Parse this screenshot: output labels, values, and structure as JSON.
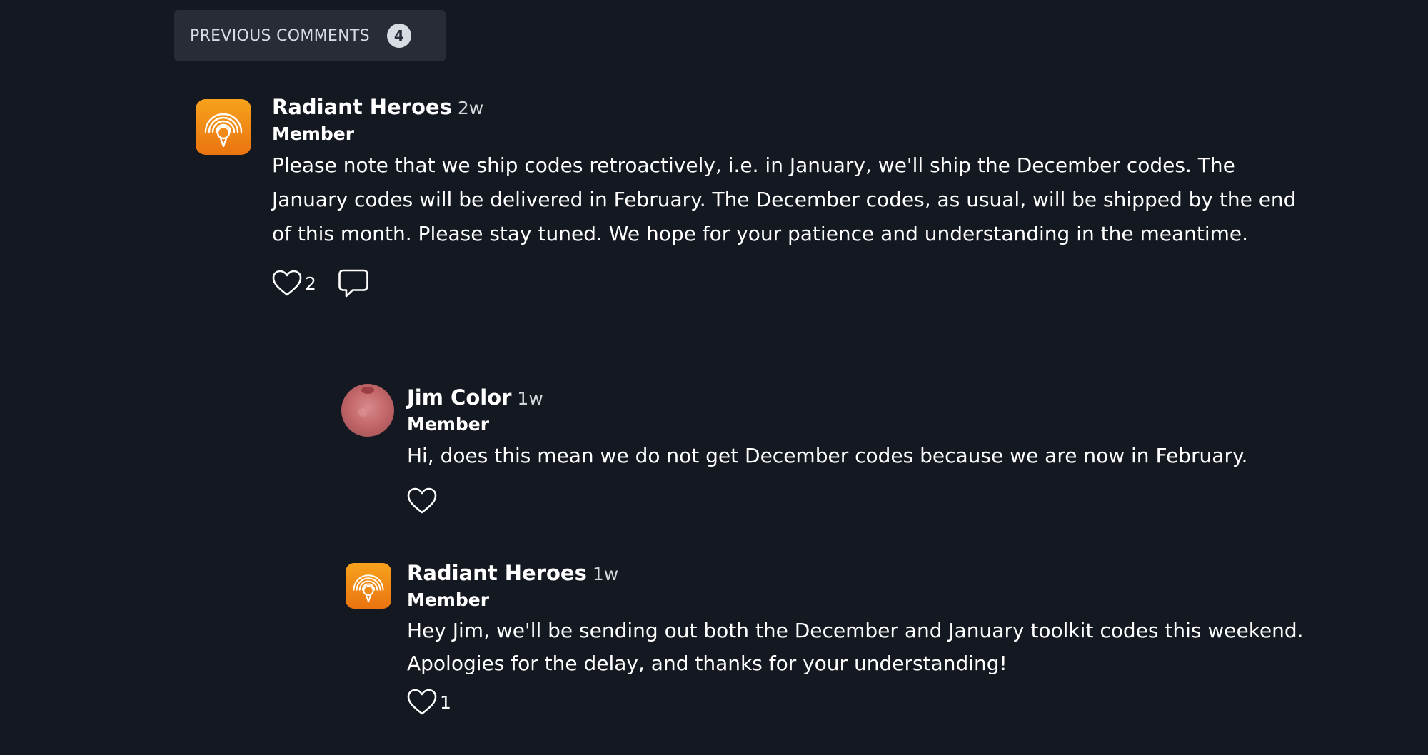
{
  "previous_comments": {
    "label": "PREVIOUS COMMENTS",
    "count": "4"
  },
  "comments": [
    {
      "author": "Radiant Heroes",
      "time": "2w",
      "role": "Member",
      "text": "Please note that we ship codes retroactively, i.e. in January, we'll ship the December codes. The January codes will be delivered in February. The December codes, as usual, will be shipped by the end of this month. Please stay tuned. We hope for your patience and understanding in the meantime.",
      "likes": "2",
      "avatar_icon": "radiant-heroes-logo",
      "avatar_color": "#f08a17"
    },
    {
      "author": "Jim Color",
      "time": "1w",
      "role": "Member",
      "text": "Hi, does this mean we do not get December codes because we are now in February.",
      "likes": "",
      "avatar_icon": "user-photo",
      "avatar_color": "#c76a6e"
    },
    {
      "author": "Radiant Heroes",
      "time": "1w",
      "role": "Member",
      "text": "Hey Jim, we'll be sending out both the December and January toolkit codes this weekend. Apologies for the delay, and thanks for your understanding!",
      "likes": "1",
      "avatar_icon": "radiant-heroes-logo",
      "avatar_color": "#f08a17"
    }
  ]
}
